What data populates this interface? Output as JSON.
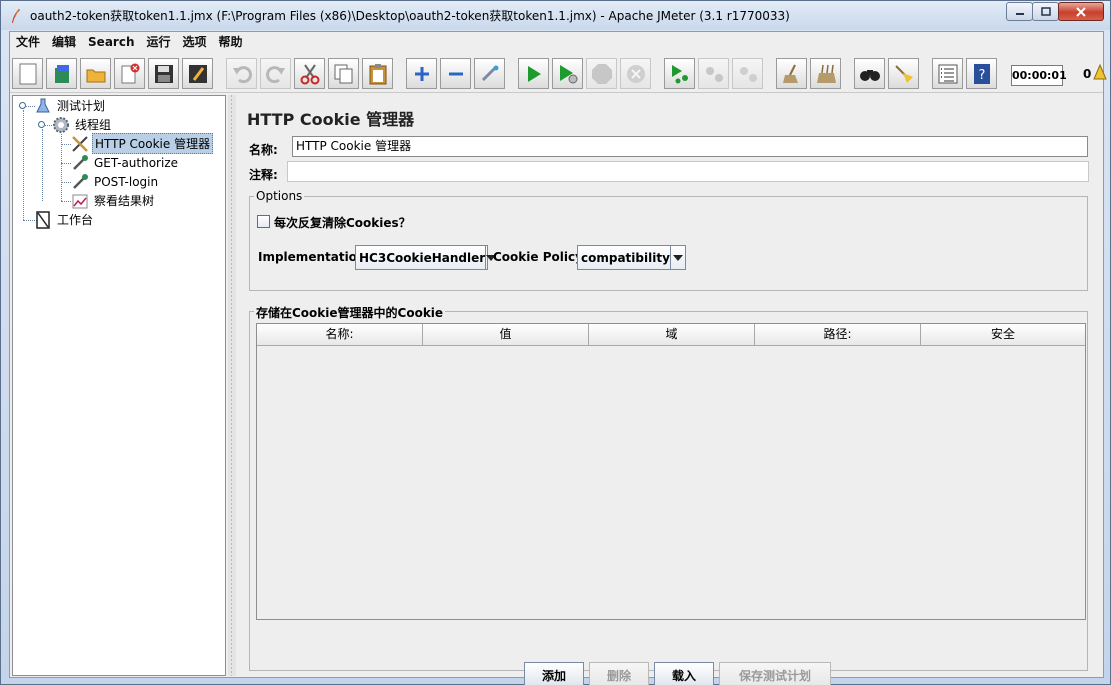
{
  "window": {
    "title": "oauth2-token获取token1.1.jmx (F:\\Program Files (x86)\\Desktop\\oauth2-token获取token1.1.jmx) - Apache JMeter (3.1 r1770033)"
  },
  "menu": [
    "文件",
    "编辑",
    "Search",
    "运行",
    "选项",
    "帮助"
  ],
  "toolbar": {
    "timer": "00:00:01",
    "error_count": "0"
  },
  "tree": {
    "nodes": [
      {
        "label": "测试计划"
      },
      {
        "label": "线程组"
      },
      {
        "label": "HTTP Cookie 管理器"
      },
      {
        "label": "GET-authorize"
      },
      {
        "label": "POST-login"
      },
      {
        "label": "察看结果树"
      },
      {
        "label": "工作台"
      }
    ]
  },
  "panel": {
    "title": "HTTP Cookie 管理器",
    "name_label": "名称:",
    "name_value": "HTTP Cookie 管理器",
    "comment_label": "注释:",
    "comment_value": "",
    "options": {
      "legend": "Options",
      "clear_each_iteration": "每次反复清除Cookies？",
      "clear_checked": false,
      "implementation_label": "Implementation:",
      "implementation_value": "HC3CookieHandler",
      "policy_label": "Cookie Policy:",
      "policy_value": "compatibility"
    },
    "cookies": {
      "legend": "存储在Cookie管理器中的Cookie",
      "columns": [
        "名称:",
        "值",
        "域",
        "路径:",
        "安全"
      ],
      "rows": []
    },
    "buttons": {
      "add": "添加",
      "delete": "删除",
      "load": "载入",
      "save": "保存测试计划"
    }
  },
  "colors": {
    "selection": "#b8cfe5",
    "run_green": "#1f9a2e"
  }
}
